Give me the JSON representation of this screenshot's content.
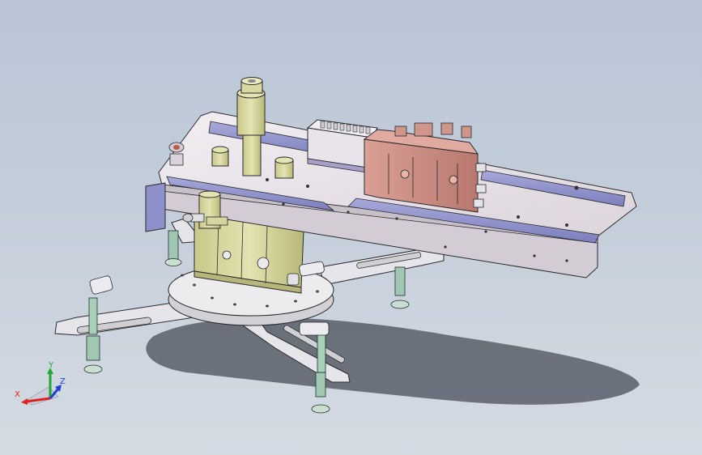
{
  "viewport": {
    "background_top": "#b9c5d6",
    "background_bottom": "#d4dbe3"
  },
  "model": {
    "plate_color": "#e6e1e6",
    "rail_color": "#8f92c9",
    "valve_color": "#c98f86",
    "cylinder_color": "#d4d39e",
    "base_color": "#e4e4e6",
    "fitting_color": "#9fc7b2"
  },
  "triad": {
    "x_label": "X",
    "y_label": "Y",
    "z_label": "Z",
    "x_color": "#e0201e",
    "y_color": "#1ea832",
    "z_color": "#2040d8"
  }
}
